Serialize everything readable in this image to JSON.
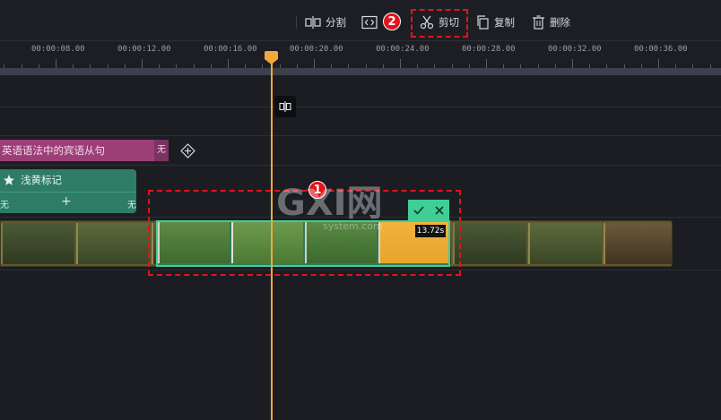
{
  "toolbar": {
    "split_label": "分割",
    "cut_label": "剪切",
    "copy_label": "复制",
    "delete_label": "删除"
  },
  "ruler": {
    "times": [
      "00:00:08.00",
      "00:00:12.00",
      "00:00:16.00",
      "00:00:20.00",
      "00:00:24.00",
      "00:00:28.00",
      "00:00:32.00",
      "00:00:36.00"
    ]
  },
  "tracks": {
    "subtitle": {
      "label": "英语语法中的宾语从句",
      "tail": "无"
    },
    "sticker": {
      "label": "浅黄标记",
      "left_text": "无",
      "right_text": "无",
      "add_symbol": "+"
    },
    "selected_clip": {
      "duration": "13.72s"
    }
  },
  "annotations": {
    "step1": "1",
    "step2": "2"
  },
  "watermark": {
    "text": "GXI网",
    "sub": "system.com"
  },
  "colors": {
    "accent": "#f2a93b",
    "selection": "#3fcf96",
    "annotation": "#e0141b",
    "subtitle": "#9c3f79",
    "sticker": "#2e7c66"
  }
}
